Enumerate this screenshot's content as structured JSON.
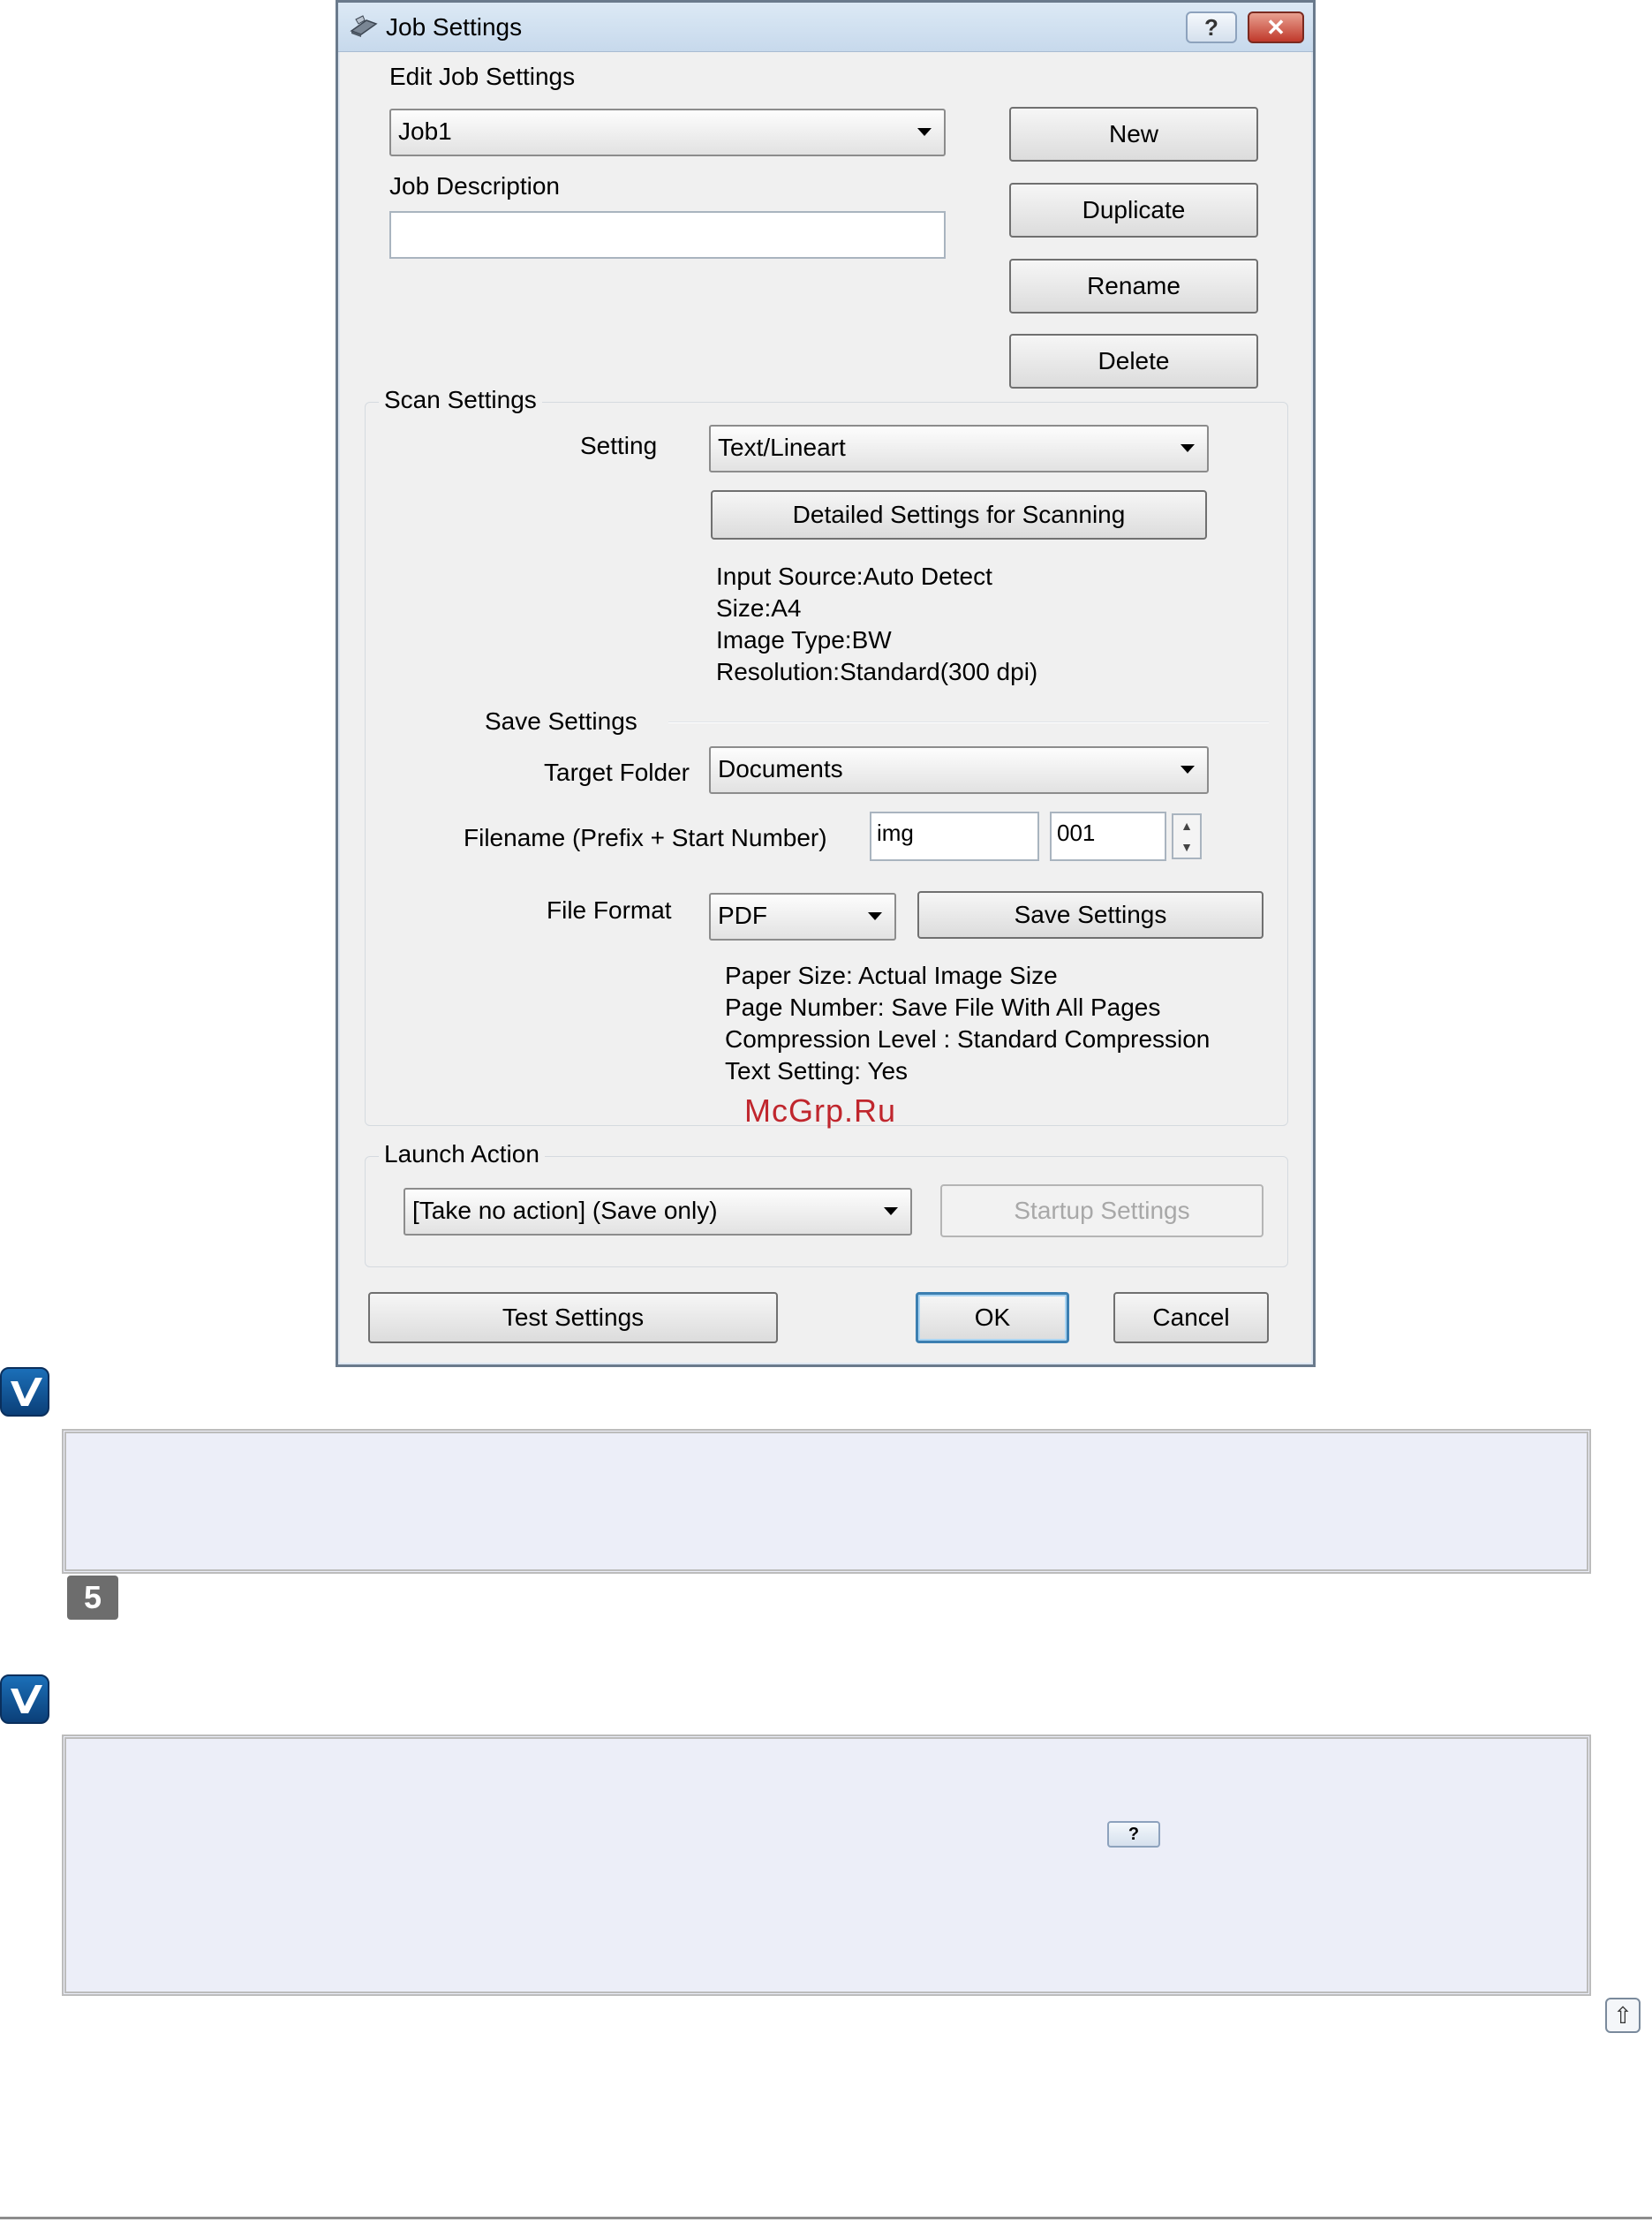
{
  "dialog": {
    "title": "Job Settings",
    "help_glyph": "?",
    "close_glyph": "✕",
    "edit_job_label": "Edit Job Settings",
    "job_select": "Job1",
    "job_description_label": "Job Description",
    "job_description_value": "",
    "buttons": {
      "new": "New",
      "duplicate": "Duplicate",
      "rename": "Rename",
      "delete": "Delete"
    },
    "scan_settings": {
      "caption": "Scan Settings",
      "setting_label": "Setting",
      "setting_value": "Text/Lineart",
      "detailed_button": "Detailed Settings for Scanning",
      "info": [
        "Input Source:Auto Detect",
        "Size:A4",
        "Image Type:BW",
        "Resolution:Standard(300 dpi)"
      ]
    },
    "save_settings": {
      "caption": "Save Settings",
      "target_folder_label": "Target Folder",
      "target_folder_value": "Documents",
      "filename_label": "Filename (Prefix + Start Number)",
      "prefix_value": "img",
      "start_number_value": "001",
      "file_format_label": "File Format",
      "file_format_value": "PDF",
      "save_settings_button": "Save Settings",
      "info": [
        "Paper Size: Actual Image Size",
        "Page Number: Save File With All Pages",
        "Compression Level : Standard Compression",
        "Text Setting: Yes"
      ]
    },
    "launch_action": {
      "caption": "Launch Action",
      "value": "[Take no action] (Save only)",
      "startup_button": "Startup Settings"
    },
    "footer": {
      "test_settings": "Test Settings",
      "ok": "OK",
      "cancel": "Cancel"
    }
  },
  "page": {
    "watermark": "McGrp.Ru",
    "step_number": "5",
    "help_button_glyph": "?",
    "top_button_glyph": "⇧"
  },
  "icons": [
    "scanner-icon",
    "help-icon",
    "close-icon",
    "note-checkmark-icon",
    "spin-up-icon",
    "spin-down-icon",
    "back-to-top-icon"
  ],
  "colors": {
    "note_background": "#eceef8",
    "note_icon": "#1b6fb8",
    "watermark": "#c0262d",
    "step_badge": "#6d6d6d"
  }
}
